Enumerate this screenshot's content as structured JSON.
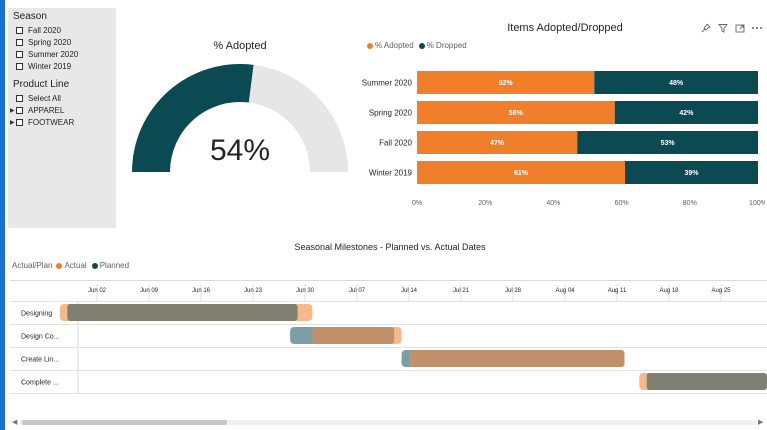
{
  "slicers": {
    "season": {
      "title": "Season",
      "items": [
        "Fall 2020",
        "Spring 2020",
        "Summer 2020",
        "Winter 2019"
      ]
    },
    "product_line": {
      "title": "Product Line",
      "items": [
        {
          "label": "Select All",
          "expandable": false
        },
        {
          "label": "APPAREL",
          "expandable": true
        },
        {
          "label": "FOOTWEAR",
          "expandable": true
        }
      ]
    }
  },
  "donut": {
    "title": "% Adopted",
    "value_label": "54%",
    "fraction": 0.54,
    "colors": {
      "value": "#0b4a53",
      "rest": "#e6e6e6"
    }
  },
  "bar_chart": {
    "title": "Items Adopted/Dropped",
    "toolbar_icons": [
      "pin-icon",
      "filter-icon",
      "focus-mode-icon",
      "more-options-icon"
    ]
  },
  "gantt": {
    "title": "Seasonal Milestones - Planned vs. Actual Dates",
    "legend_label": "Actual/Plan",
    "legend_items": [
      {
        "name": "Actual",
        "color": "#f07f2c"
      },
      {
        "name": "Planned",
        "color": "#0b4a53"
      }
    ],
    "ticks": [
      "Jun 02",
      "Jun 09",
      "Jun 16",
      "Jun 23",
      "Jun 30",
      "Jul 07",
      "Jul 14",
      "Jul 21",
      "Jul 28",
      "Aug 04",
      "Aug 11",
      "Aug 18",
      "Aug 25"
    ],
    "rows": [
      {
        "label": "Designing",
        "actual": [
          "2020-05-28",
          "2020-07-01"
        ],
        "planned": [
          "2020-05-29",
          "2020-06-29"
        ]
      },
      {
        "label": "Design Co...",
        "actual": [
          "2020-07-01",
          "2020-07-13"
        ],
        "planned": [
          "2020-06-28",
          "2020-07-12"
        ]
      },
      {
        "label": "Create Lin...",
        "actual": [
          "2020-07-14",
          "2020-08-12"
        ],
        "planned": [
          "2020-07-13",
          "2020-08-12"
        ]
      },
      {
        "label": "Complete ...",
        "actual": [
          "2020-08-14",
          "2020-09-01"
        ],
        "planned": [
          "2020-08-15",
          "2020-09-01"
        ]
      }
    ],
    "colors": {
      "actual": "#f5b98b",
      "planned": "#7a9ea4",
      "overlap": "#7f7f72",
      "overlap_actual": "#c0916a"
    }
  },
  "chart_data": {
    "type": "bar",
    "title": "Items Adopted/Dropped",
    "categories": [
      "Summer 2020",
      "Spring 2020",
      "Fall 2020",
      "Winter 2019"
    ],
    "series": [
      {
        "name": "% Adopted",
        "values": [
          52,
          58,
          47,
          61
        ],
        "color": "#f07f2c"
      },
      {
        "name": "% Dropped",
        "values": [
          48,
          42,
          53,
          39
        ],
        "color": "#0b4a53"
      }
    ],
    "value_labels": [
      [
        "52%",
        "48%"
      ],
      [
        "58%",
        "42%"
      ],
      [
        "47%",
        "53%"
      ],
      [
        "61%",
        "39%"
      ]
    ],
    "x_ticks": [
      "0%",
      "20%",
      "40%",
      "60%",
      "80%",
      "100%"
    ],
    "xlim": [
      0,
      100
    ],
    "stacked": true,
    "orientation": "horizontal",
    "legend_position": "top-left"
  }
}
